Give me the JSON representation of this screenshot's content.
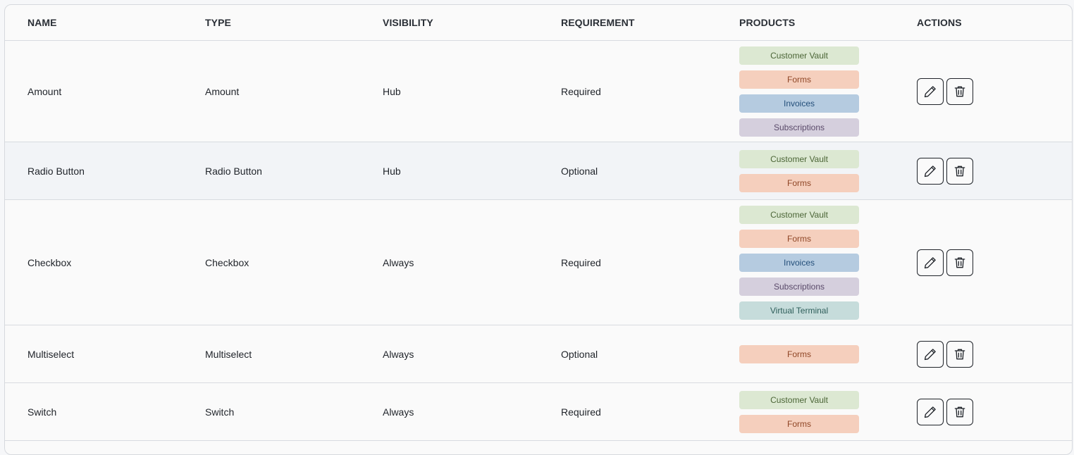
{
  "columns": {
    "name": "NAME",
    "type": "TYPE",
    "visibility": "VISIBILITY",
    "requirement": "REQUIREMENT",
    "products": "PRODUCTS",
    "actions": "ACTIONS"
  },
  "rows": [
    {
      "name": "Amount",
      "type": "Amount",
      "visibility": "Hub",
      "requirement": "Required",
      "products": [
        "Customer Vault",
        "Forms",
        "Invoices",
        "Subscriptions"
      ]
    },
    {
      "name": "Radio Button",
      "type": "Radio Button",
      "visibility": "Hub",
      "requirement": "Optional",
      "products": [
        "Customer Vault",
        "Forms"
      ]
    },
    {
      "name": "Checkbox",
      "type": "Checkbox",
      "visibility": "Always",
      "requirement": "Required",
      "products": [
        "Customer Vault",
        "Forms",
        "Invoices",
        "Subscriptions",
        "Virtual Terminal"
      ]
    },
    {
      "name": "Multiselect",
      "type": "Multiselect",
      "visibility": "Always",
      "requirement": "Optional",
      "products": [
        "Forms"
      ]
    },
    {
      "name": "Switch",
      "type": "Switch",
      "visibility": "Always",
      "requirement": "Required",
      "products": [
        "Customer Vault",
        "Forms"
      ]
    }
  ],
  "icons": {
    "edit": "pencil-icon",
    "delete": "trash-icon"
  },
  "colors": {
    "Customer Vault": "#dce8d2",
    "Forms": "#f5cfbd",
    "Invoices": "#b5cbe0",
    "Subscriptions": "#d5cfdd",
    "Virtual Terminal": "#c6dcdb"
  }
}
